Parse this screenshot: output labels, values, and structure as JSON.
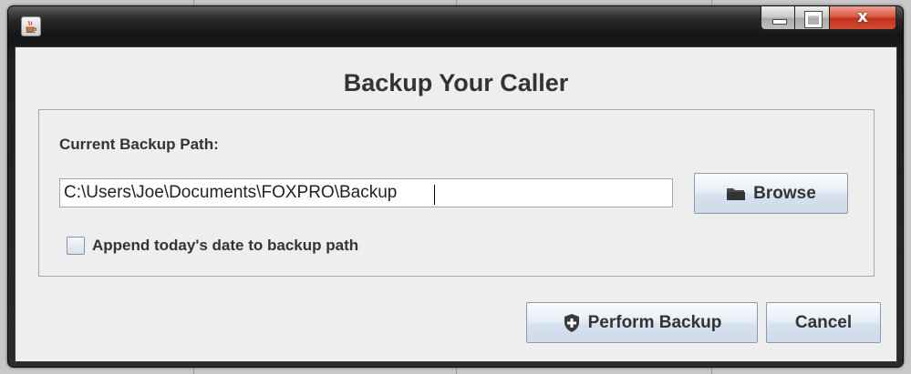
{
  "window": {
    "icon": "java-coffee-icon",
    "controls": [
      "minimize-icon",
      "maximize-icon",
      "close-icon"
    ],
    "close_glyph": "x"
  },
  "dialog": {
    "title": "Backup Your Caller",
    "path_label": "Current Backup Path:",
    "path_value": "C:\\Users\\Joe\\Documents\\FOXPRO\\Backup",
    "browse_label": "Browse",
    "browse_icon": "folder-icon",
    "append_date_label": "Append today's date to backup path",
    "append_date_checked": false,
    "perform_label": "Perform Backup",
    "perform_icon": "shield-plus-icon",
    "cancel_label": "Cancel"
  },
  "colors": {
    "titlebar": "#1a1a1a",
    "close_button": "#c8392b",
    "dialog_bg": "#eeeeee",
    "button_gradient_top": "#fbfdff",
    "button_gradient_bottom": "#cfdaea"
  }
}
